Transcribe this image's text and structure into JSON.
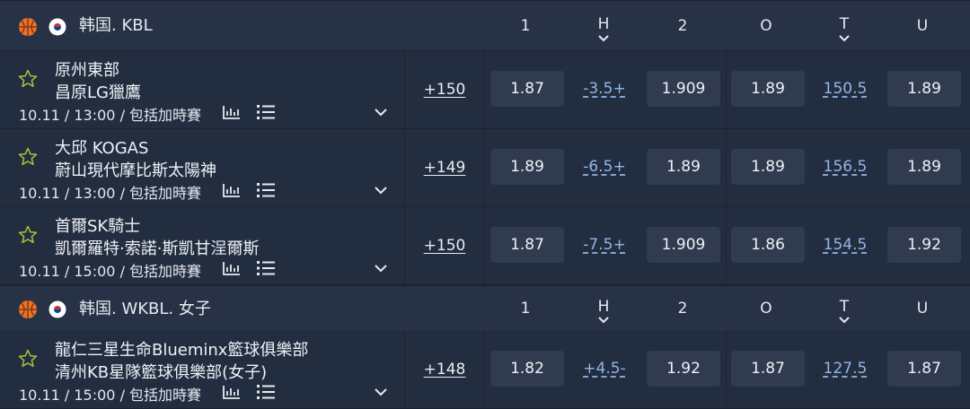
{
  "columns": [
    "1",
    "H",
    "2",
    "O",
    "T",
    "U"
  ],
  "leagues": [
    {
      "name": "韩国. KBL",
      "matches": [
        {
          "team1": "原州東部",
          "team2": "昌原LG獵鷹",
          "time": "10.11 / 13:00 / 包括加時賽",
          "more": "+150",
          "odds": {
            "one": "1.87",
            "handicap": "-3.5+",
            "two": "1.909",
            "over": "1.89",
            "total": "150.5",
            "under": "1.89"
          }
        },
        {
          "team1": "大邱 KOGAS",
          "team2": "蔚山現代摩比斯太陽神",
          "time": "10.11 / 13:00 / 包括加時賽",
          "more": "+149",
          "odds": {
            "one": "1.89",
            "handicap": "-6.5+",
            "two": "1.89",
            "over": "1.89",
            "total": "156.5",
            "under": "1.89"
          }
        },
        {
          "team1": "首爾SK騎士",
          "team2": "凱爾羅特·索諾·斯凱甘浧爾斯",
          "time": "10.11 / 15:00 / 包括加時賽",
          "more": "+150",
          "odds": {
            "one": "1.87",
            "handicap": "-7.5+",
            "two": "1.909",
            "over": "1.86",
            "total": "154.5",
            "under": "1.92"
          }
        }
      ]
    },
    {
      "name": "韩国. WKBL. 女子",
      "matches": [
        {
          "team1": "龍仁三星生命Blueminx籃球俱樂部",
          "team2": "清州KB星隊籃球俱樂部(女子)",
          "time": "10.11 / 15:00 / 包括加時賽",
          "more": "+148",
          "odds": {
            "one": "1.82",
            "handicap": "+4.5-",
            "two": "1.92",
            "over": "1.87",
            "total": "127.5",
            "under": "1.87"
          }
        }
      ]
    }
  ],
  "colors": {
    "accent_link": "#93b6e6",
    "star": "#a8c23a",
    "ball": "#e8742c"
  },
  "icons": [
    "basketball-icon",
    "korea-flag-icon",
    "star-icon",
    "stats-icon",
    "list-icon",
    "chevron-down-icon"
  ]
}
